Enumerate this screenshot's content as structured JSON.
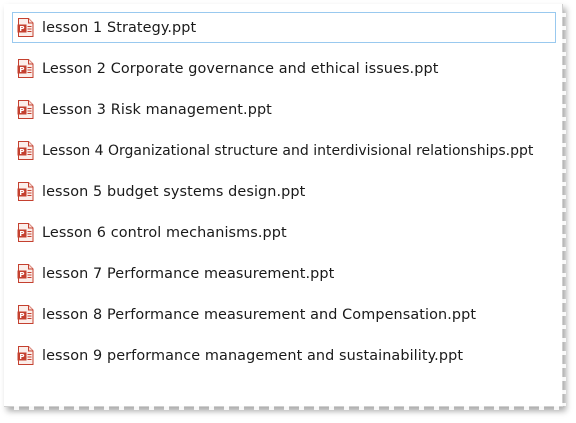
{
  "files": [
    {
      "name": "lesson 1 Strategy.ppt",
      "icon": "powerpoint-file-icon",
      "selected": true
    },
    {
      "name": "Lesson 2 Corporate governance and ethical issues.ppt",
      "icon": "powerpoint-file-icon",
      "selected": false
    },
    {
      "name": "Lesson 3 Risk management.ppt",
      "icon": "powerpoint-file-icon",
      "selected": false
    },
    {
      "name": "Lesson 4 Organizational structure and interdivisional relationships.ppt",
      "icon": "powerpoint-file-icon",
      "selected": false
    },
    {
      "name": "lesson 5 budget systems design.ppt",
      "icon": "powerpoint-file-icon",
      "selected": false
    },
    {
      "name": "Lesson 6 control mechanisms.ppt",
      "icon": "powerpoint-file-icon",
      "selected": false
    },
    {
      "name": "lesson 7 Performance measurement.ppt",
      "icon": "powerpoint-file-icon",
      "selected": false
    },
    {
      "name": "lesson 8 Performance measurement and Compensation.ppt",
      "icon": "powerpoint-file-icon",
      "selected": false
    },
    {
      "name": "lesson 9 performance management and sustainability.ppt",
      "icon": "powerpoint-file-icon",
      "selected": false
    }
  ],
  "colors": {
    "selection_border": "#99c9ef",
    "icon_red": "#c4402f",
    "text": "#1a1a1a"
  }
}
